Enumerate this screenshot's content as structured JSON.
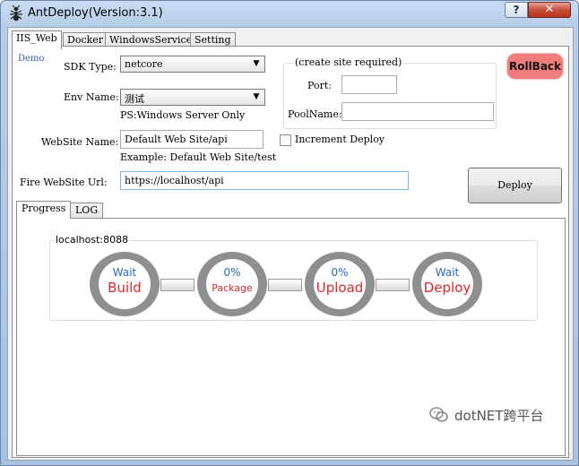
{
  "window": {
    "title": "AntDeploy(Version:3.1)",
    "help_label": "?",
    "close_label": "✕"
  },
  "tabs": [
    {
      "label": "IIS_Web",
      "active": true
    },
    {
      "label": "Docker"
    },
    {
      "label": "WindowsService"
    },
    {
      "label": "Setting"
    }
  ],
  "iis": {
    "demo_label": "Demo",
    "sdk_label": "SDK Type:",
    "sdk_value": "netcore",
    "env_label": "Env Name:",
    "env_value": "测试",
    "env_note": "PS:Windows Server Only",
    "website_label": "WebSite Name:",
    "website_value": "Default Web Site/api",
    "website_example": "Example: Default Web Site/test",
    "increment_label": "Increment Deploy",
    "create_group_label": "(create site required)",
    "port_label": "Port:",
    "port_value": "",
    "pool_label": "PoolName:",
    "pool_value": "",
    "fire_label": "Fire WebSite Url:",
    "fire_value": "https://localhost/api",
    "rollback_label": "RollBack",
    "deploy_label": "Deploy"
  },
  "inner_tabs": [
    {
      "label": "Progress",
      "active": true
    },
    {
      "label": "LOG"
    }
  ],
  "progress": {
    "server_label": "localhost:8088",
    "stages": [
      {
        "status": "Wait",
        "name": "Build"
      },
      {
        "status": "0%",
        "name": "Package"
      },
      {
        "status": "0%",
        "name": "Upload"
      },
      {
        "status": "Wait",
        "name": "Deploy"
      }
    ]
  },
  "watermark": {
    "text": "dotNET跨平台"
  },
  "colors": {
    "rollback_bg": "#f07c7c",
    "stage_ring": "#8f8f8f",
    "stage_status": "#2b66c4",
    "stage_name": "#e12626",
    "demo_link": "#3a58a7"
  }
}
